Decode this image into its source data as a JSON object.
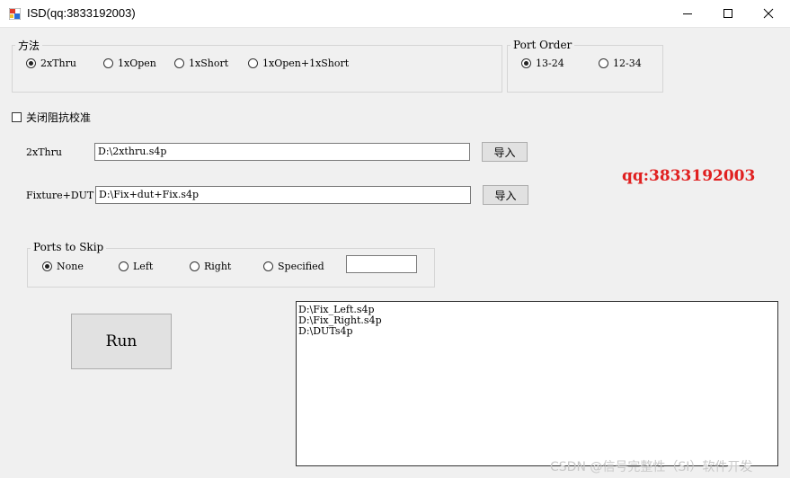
{
  "window": {
    "title": "ISD(qq:3833192003)",
    "minimize_glyph": "—",
    "maximize_glyph": "☐",
    "close_glyph": "✕"
  },
  "method_group": {
    "legend": "方法",
    "options": [
      "2xThru",
      "1xOpen",
      "1xShort",
      "1xOpen+1xShort"
    ],
    "selected": "2xThru"
  },
  "port_order_group": {
    "legend": "Port Order",
    "options": [
      "13-24",
      "12-34"
    ],
    "selected": "13-24"
  },
  "close_impedance": {
    "label": "关闭阻抗校准",
    "checked": false
  },
  "thru_row": {
    "label": "2xThru",
    "value": "D:\\2xthru.s4p",
    "button": "导入"
  },
  "fixture_row": {
    "label": "Fixture+DUT",
    "value": "D:\\Fix+dut+Fix.s4p",
    "button": "导入"
  },
  "watermark_qq": "qq:3833192003",
  "ports_to_skip": {
    "legend": "Ports to Skip",
    "options": [
      "None",
      "Left",
      "Right",
      "Specified"
    ],
    "selected": "None",
    "specified_value": ""
  },
  "run_button": "Run",
  "output_lines": [
    "D:\\Fix_Left.s4p",
    "D:\\Fix_Right.s4p",
    "D:\\DUTs4p"
  ],
  "footer_watermark": "CSDN @信号完整性（SI）软件开发",
  "colors": {
    "qq_red": "#e02020",
    "icon_red": "#e23b2b",
    "icon_blue": "#2a6fd6"
  }
}
